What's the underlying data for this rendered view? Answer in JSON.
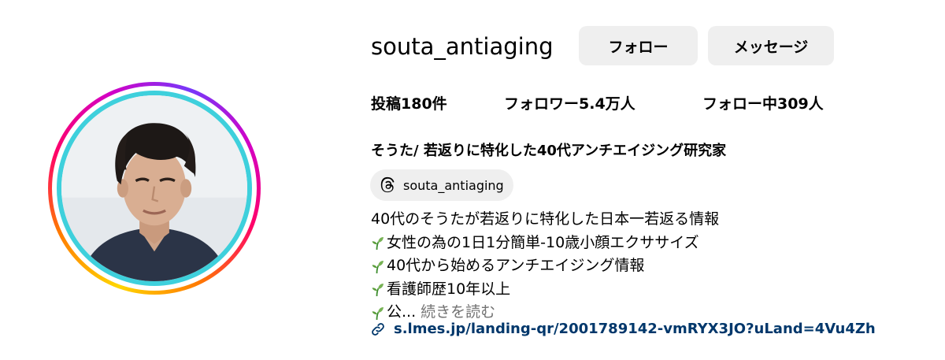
{
  "profile": {
    "username": "souta_antiaging",
    "full_name": "そうた/ 若返りに特化した40代アンチエイジング研究家",
    "threads_handle": "souta_antiaging"
  },
  "actions": {
    "follow_label": "フォロー",
    "message_label": "メッセージ"
  },
  "stats": {
    "posts_label": "投稿",
    "posts_count": "180件",
    "followers_label": "フォロワー",
    "followers_count": "5.4万人",
    "following_label": "フォロー中",
    "following_count": "309人"
  },
  "bio": {
    "line1": "40代のそうたが若返りに特化した日本一若返る情報",
    "line2": "女性の為の1日1分簡単-10歳小顔エクササイズ",
    "line3": "40代から始めるアンチエイジング情報",
    "line4": "看護師歴10年以上",
    "line5": "公...",
    "more_label": "続きを読む"
  },
  "link": {
    "url_text": "s.lmes.jp/landing-qr/2001789142-vmRYX3JO?uLand=4Vu4Zh"
  },
  "icons": {
    "threads": "threads-icon",
    "sprout": "seedling-icon",
    "link": "link-icon"
  },
  "colors": {
    "button_bg": "#efefef",
    "link": "#00376b",
    "muted": "#737373",
    "ring_inner": "#3ed0dc"
  }
}
